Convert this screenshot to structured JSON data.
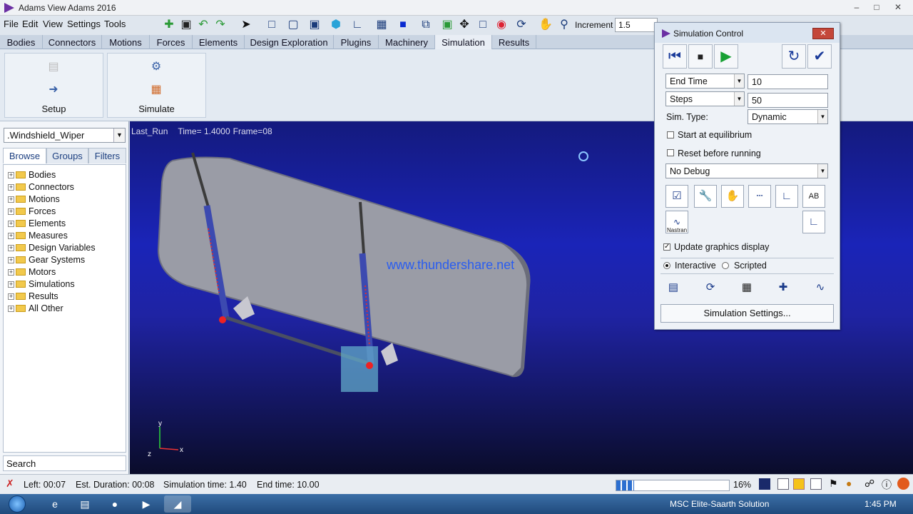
{
  "window": {
    "title": "Adams View Adams 2016"
  },
  "menu": [
    "File",
    "Edit",
    "View",
    "Settings",
    "Tools"
  ],
  "toolbar": {
    "increment_label": "Increment",
    "increment_value": "1.5"
  },
  "ribbon_tabs": [
    "Bodies",
    "Connectors",
    "Motions",
    "Forces",
    "Elements",
    "Design Exploration",
    "Plugins",
    "Machinery",
    "Simulation",
    "Results"
  ],
  "active_tab": "Simulation",
  "ribbon_groups": {
    "setup": "Setup",
    "simulate": "Simulate"
  },
  "left_panel": {
    "model": ".Windshield_Wiper",
    "tabs": [
      "Browse",
      "Groups",
      "Filters"
    ],
    "tree": [
      "Bodies",
      "Connectors",
      "Motions",
      "Forces",
      "Elements",
      "Measures",
      "Design Variables",
      "Gear Systems",
      "Motors",
      "Simulations",
      "Results",
      "All Other"
    ],
    "search": "Search"
  },
  "viewport": {
    "run": "Last_Run",
    "time": "Time=  1.4000",
    "frame": "Frame=08",
    "watermark": "www.thundershare.net",
    "axis_x": "x",
    "axis_y": "y",
    "axis_z": "z"
  },
  "sim_control": {
    "title": "Simulation Control",
    "end_mode": "End Time",
    "end_value": "10",
    "steps_mode": "Steps",
    "steps_value": "50",
    "sim_type_label": "Sim. Type:",
    "sim_type": "Dynamic",
    "start_equilibrium": "Start at equilibrium",
    "reset_before": "Reset before running",
    "debug": "No Debug",
    "nastran": "Nastran",
    "update_graphics": "Update graphics display",
    "interactive": "Interactive",
    "scripted": "Scripted",
    "settings_button": "Simulation Settings..."
  },
  "status": {
    "left": "Left: 00:07",
    "est_duration": "Est. Duration: 00:08",
    "sim_time": "Simulation time: 1.40",
    "end_time": "End time: 10.00",
    "percent": "16%"
  },
  "taskbar": {
    "tray_text": "MSC Elite-Saarth Solution",
    "clock": "1:45 PM"
  },
  "colors": {
    "viewport_top": "#141a7e",
    "accent": "#1c3f80"
  }
}
